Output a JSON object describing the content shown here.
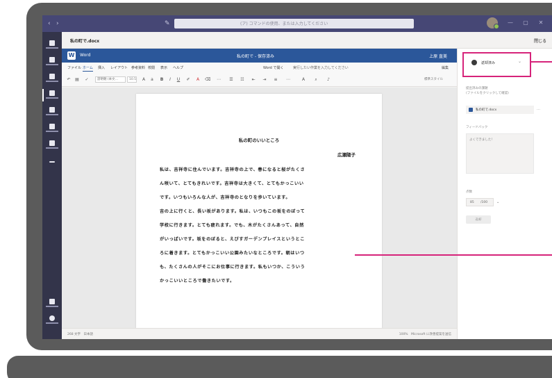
{
  "teams": {
    "search_placeholder": "(ア) コマンドの使用、または入力してください",
    "tab_title": "私の町で.docx",
    "close_label": "閉じる"
  },
  "rail": {
    "items": [
      "アクティビティ",
      "チャット",
      "チーム",
      "課題",
      "カレンダー",
      "通話",
      "ファイル",
      "その他",
      "アプリ",
      "ヘルプ"
    ]
  },
  "word": {
    "app_label": "Word",
    "doc_name": "私の町で - 保存済み",
    "user": "上原 直美",
    "menu": [
      "ファイル",
      "ホーム",
      "挿入",
      "レイアウト",
      "参考資料",
      "校閲",
      "表示",
      "ヘルプ",
      "Word で開く"
    ],
    "active_menu_index": 1,
    "tell_me": "実行したい作業を入力してください",
    "edit_mode": "編集",
    "font_name": "游明朝 (本文…",
    "font_size": "10.5",
    "style_name": "標準スタイル",
    "format_icons": [
      "B",
      "I",
      "U"
    ]
  },
  "document": {
    "title": "私の町のいいところ",
    "author": "広瀬陽子",
    "lines": [
      "私は、吉祥寺に住んでいます。吉祥寺の上で、春になると桜がたくさ",
      "ん咲いて、とてもきれいです。吉祥寺は大きくて、とてもかっこいい",
      "です。いつもいろんな人が、吉祥寺のとなりを歩いています。",
      "吉の上に行くと、長い坂があります。私は、いつもこの坂をのぼって",
      "学校に行きます。とても疲れます。でも、木がたくさんあって、自然",
      "がいっぱいです。坂をのぼると、えびすガーデンプレイスというとこ",
      "ろに着きます。とてもかっこいい公園みたいなところです。朝はいつ",
      "も、たくさんの人がそこにお仕事に行きます。私もいつか、こういう",
      "かっこいいところで働きたいです。"
    ]
  },
  "status": {
    "left": "268 文字　日本語",
    "right": "100%　Microsoft に改善提案を送信"
  },
  "panel": {
    "assign_label": "返却済み",
    "file_section_label": "提出済みの課題",
    "file_section_sub": "(ファイルをクリックして確認)",
    "file_name": "私の町で.docx",
    "feedback_label": "フィードバック",
    "feedback_text": "よくできました！",
    "points_label": "点数",
    "points_value": "/100",
    "points_score": "85",
    "return_label": "返却"
  },
  "colors": {
    "teams_purple": "#464775",
    "word_blue": "#2b579a",
    "callout": "#d6237a",
    "laptop": "#5b5b5b"
  }
}
